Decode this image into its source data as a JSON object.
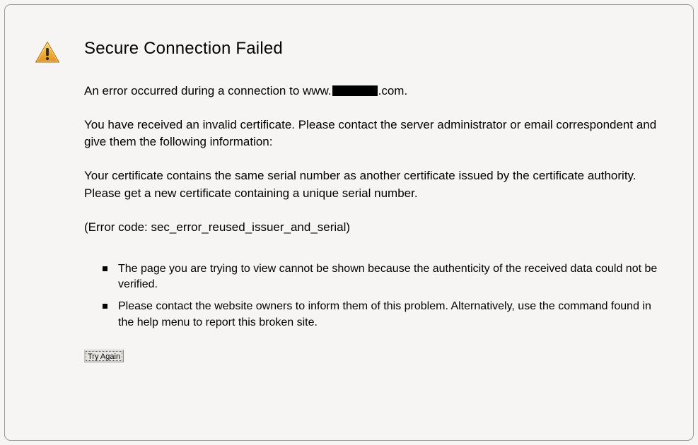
{
  "title": "Secure Connection Failed",
  "intro": {
    "prefix": "An error occurred during a connection to www.",
    "suffix": ".com."
  },
  "para1": "You have received an invalid certificate.  Please contact the server administrator or email correspondent and give them the following information:",
  "para2": "Your certificate contains the same serial number as another certificate issued by the certificate authority.  Please get a new certificate containing a unique serial number.",
  "error_code_line": "(Error code: sec_error_reused_issuer_and_serial)",
  "bullets": [
    "The page you are trying to view cannot be shown because the authenticity of the received data could not be verified.",
    "Please contact the website owners to inform them of this problem. Alternatively, use the command found in the help menu to report this broken site."
  ],
  "try_again_label": "Try Again"
}
